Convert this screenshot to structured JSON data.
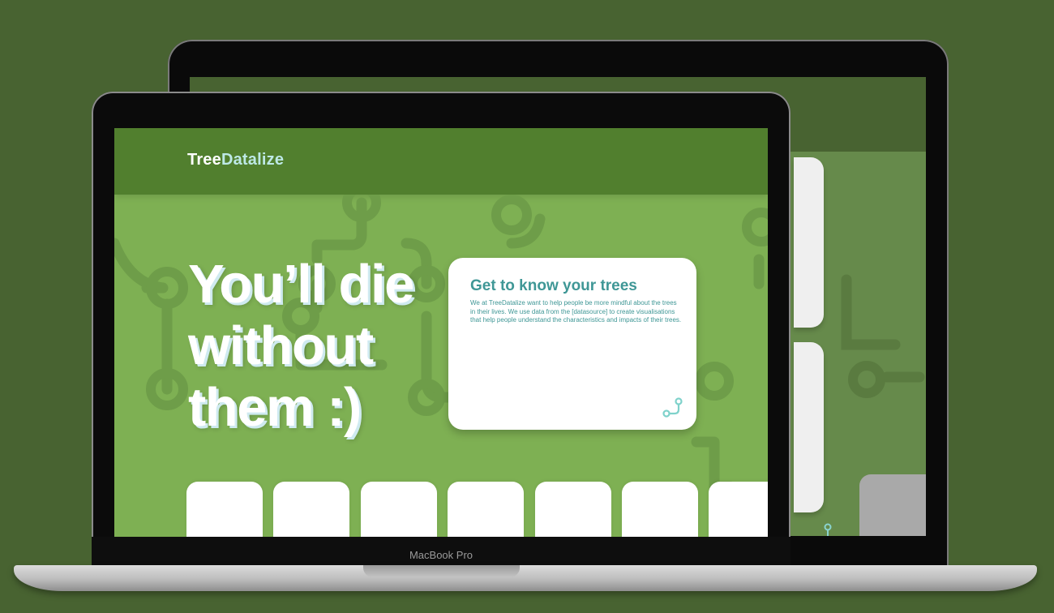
{
  "device": {
    "label": "MacBook Pro"
  },
  "site": {
    "brand_part1": "Tree",
    "brand_part2": "Datalize",
    "hero_line1": "You’ll die",
    "hero_line2": "without",
    "hero_line3": "them :)",
    "card": {
      "title": "Get to know your trees",
      "body": "We at TreeDatalize want to help people be more mindful about the trees in their lives. We use data from the [datasource] to create visualisations that help people understand the characteristics and impacts of their trees.",
      "icon": "branch-node-icon"
    },
    "tile_count": 7
  },
  "colors": {
    "background": "#486331",
    "header": "#517f2e",
    "hero_bg": "#7eb053",
    "accent_teal": "#3f9796",
    "brand_highlight": "#bde8e5"
  }
}
